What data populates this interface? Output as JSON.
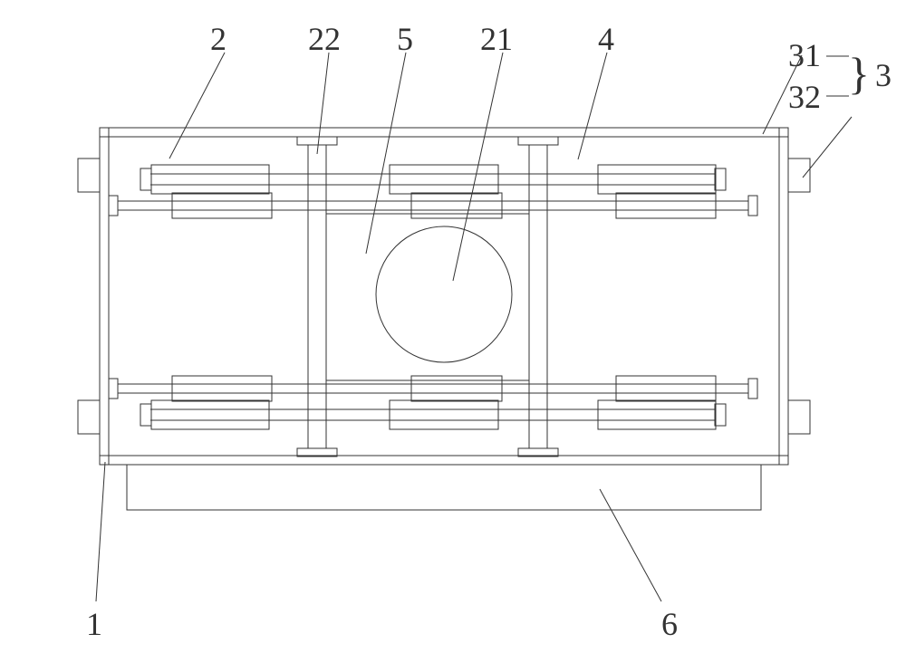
{
  "diagram": {
    "type": "technical_drawing",
    "description": "Mechanical assembly front view with labeled parts",
    "labels": {
      "ref1": "1",
      "ref2": "2",
      "ref3": "3",
      "ref4": "4",
      "ref5": "5",
      "ref6": "6",
      "ref21": "21",
      "ref22": "22",
      "ref31": "31",
      "ref32": "32"
    },
    "bracket": "}",
    "parts": [
      {
        "ref": "1",
        "desc": "outer frame left wall"
      },
      {
        "ref": "2",
        "desc": "upper housing region"
      },
      {
        "ref": "3",
        "desc": "assembly of 31 and 32"
      },
      {
        "ref": "31",
        "desc": "frame top/right structure"
      },
      {
        "ref": "32",
        "desc": "side projection"
      },
      {
        "ref": "4",
        "desc": "upper inner slide region"
      },
      {
        "ref": "5",
        "desc": "central inner block"
      },
      {
        "ref": "21",
        "desc": "central circular bore"
      },
      {
        "ref": "22",
        "desc": "vertical post"
      },
      {
        "ref": "6",
        "desc": "base plate"
      }
    ]
  }
}
